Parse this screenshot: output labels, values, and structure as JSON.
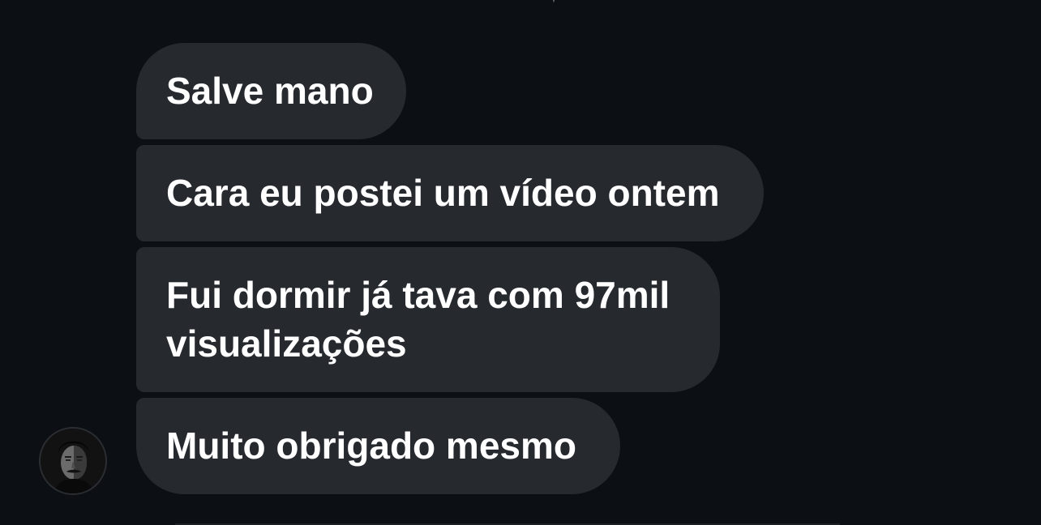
{
  "conversation": {
    "messages": [
      {
        "text": "Salve mano"
      },
      {
        "text": "Cara eu postei um vídeo ontem"
      },
      {
        "text": "Fui dormir já tava com 97mil visualizações"
      },
      {
        "text": "Muito obrigado mesmo"
      }
    ],
    "sender_avatar_icon": "profile-photo"
  },
  "colors": {
    "background": "#0c1014",
    "bubble": "#262a2f",
    "text": "#ffffff"
  }
}
